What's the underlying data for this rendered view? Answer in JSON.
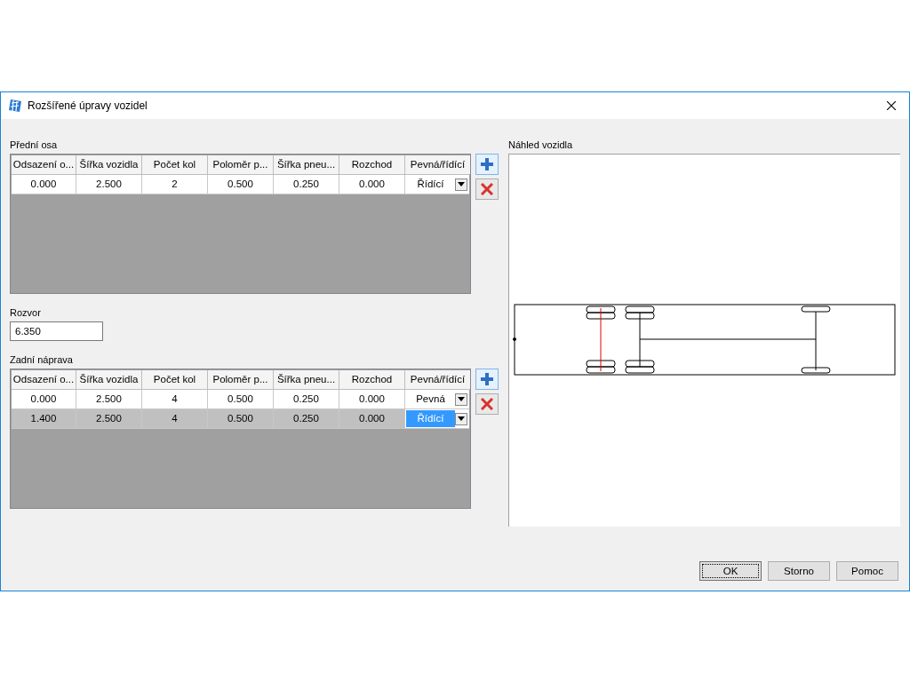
{
  "window": {
    "title": "Rozšířené úpravy vozidel"
  },
  "front_axle": {
    "label": "Přední osa",
    "columns": [
      "Odsazení o...",
      "Šířka vozidla",
      "Počet kol",
      "Poloměr p...",
      "Šířka pneu...",
      "Rozchod",
      "Pevná/řídící"
    ],
    "rows": [
      {
        "cells": [
          "0.000",
          "2.500",
          "2",
          "0.500",
          "0.250",
          "0.000"
        ],
        "mode": "Řídící",
        "selected": false
      }
    ]
  },
  "wheelbase": {
    "label": "Rozvor",
    "value": "6.350"
  },
  "rear_axle": {
    "label": "Zadní náprava",
    "columns": [
      "Odsazení o...",
      "Šířka vozidla",
      "Počet kol",
      "Poloměr p...",
      "Šířka pneu...",
      "Rozchod",
      "Pevná/řídící"
    ],
    "rows": [
      {
        "cells": [
          "0.000",
          "2.500",
          "4",
          "0.500",
          "0.250",
          "0.000"
        ],
        "mode": "Pevná",
        "selected": false
      },
      {
        "cells": [
          "1.400",
          "2.500",
          "4",
          "0.500",
          "0.250",
          "0.000"
        ],
        "mode": "Řídící",
        "selected": true
      }
    ]
  },
  "preview": {
    "label": "Náhled vozidla"
  },
  "buttons": [
    {
      "label": "OK",
      "focused": true
    },
    {
      "label": "Storno",
      "focused": false
    },
    {
      "label": "Pomoc",
      "focused": false
    }
  ]
}
